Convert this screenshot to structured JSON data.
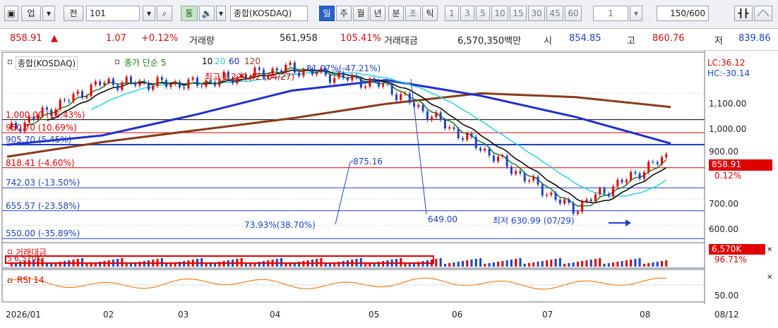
{
  "toolbar": {
    "market_label": "업",
    "period_label": "전",
    "code": "101",
    "mode_label": "통",
    "index_name": "종합(KOSDAQ)",
    "periods": [
      "일",
      "주",
      "월",
      "년",
      "분",
      "초",
      "틱"
    ],
    "active_period": "일",
    "intervals": [
      "1",
      "3",
      "5",
      "10",
      "15",
      "30",
      "45",
      "60"
    ],
    "interval_value": "1",
    "count_display": "150/600"
  },
  "quote": {
    "price": "858.91",
    "change_arrow": "▲",
    "change": "1.07",
    "change_pct": "+0.12%",
    "volume_label": "거래량",
    "volume": "561,958",
    "volume_ratio": "105.41%",
    "amount_label": "거래대금",
    "amount": "6,570,350백만",
    "open_label": "시",
    "open": "854.85",
    "high_label": "고",
    "high": "860.76",
    "low_label": "저",
    "low": "839.86"
  },
  "legend": {
    "index_label": "종합(KOSDAQ)",
    "ma_label": "종가 단순 5",
    "ma_10": "10",
    "ma_20": "20",
    "ma_60": "60",
    "ma_120": "120",
    "volume_label": "거래대금",
    "volume_ma": "5",
    "volume_ma_value": "6,570K",
    "rsi_label": "RSI 14"
  },
  "annotations": {
    "hi_label": "최고 1,229.42 (04/27)",
    "top_pct": "81.07%(-47.21%)",
    "lo_label": "최저 630.99 (07/29)",
    "mid_label": "875.16",
    "drop_label": "73.93%(38.70%)",
    "lo_point": "649.00"
  },
  "price_levels": [
    {
      "label": "1,000.00 (16.43%)",
      "value": 1000
    },
    {
      "label": "950.70 (10.69%)",
      "value": 950.7
    },
    {
      "label": "905.70 (5.45%)",
      "value": 905.7
    },
    {
      "label": "818.41 (-4.60%)",
      "value": 818.41
    },
    {
      "label": "742.03 (-13.50%)",
      "value": 742.03
    },
    {
      "label": "655.57 (-23.58%)",
      "value": 655.57
    },
    {
      "label": "550.00 (-35.89%)",
      "value": 550
    }
  ],
  "right_axis": {
    "price_ticks": [
      "1,100.00",
      "1,000.00",
      "900.00",
      "700.00",
      "600.00"
    ],
    "lc": "LC:36.12",
    "hc": "HC:-30.14",
    "current_price": "858.91",
    "current_pct": "0.12%",
    "vol_value": "6,570K",
    "vol_pct": "96.71%",
    "rsi_tick": "50.00"
  },
  "time_axis": {
    "labels": [
      "2026/01",
      "02",
      "03",
      "04",
      "05",
      "06",
      "07",
      "08"
    ],
    "end_label": "08/12"
  },
  "chart_data": {
    "type": "candlestick",
    "title": "종합(KOSDAQ)",
    "ylim": [
      540,
      1250
    ],
    "x_months": [
      "2026/01",
      "02",
      "03",
      "04",
      "05",
      "06",
      "07",
      "08"
    ],
    "highest": {
      "value": 1229.42,
      "date": "04/27"
    },
    "lowest": {
      "value": 630.99,
      "date": "07/29"
    },
    "last": {
      "value": 858.91,
      "date": "08/12"
    },
    "ma_periods": [
      5,
      10,
      20,
      60,
      120
    ],
    "ma_colors": {
      "5": "#e0a000",
      "10": "#000000",
      "20": "#2ed0e0",
      "60": "#1f2fcf",
      "120": "#8a3a1a"
    },
    "close_by_month": [
      {
        "month": "2026/01",
        "close": 955
      },
      {
        "month": "02",
        "close": 1140
      },
      {
        "month": "03",
        "close": 1135
      },
      {
        "month": "04",
        "close": 1195
      },
      {
        "month": "05",
        "close": 1130
      },
      {
        "month": "06",
        "close": 900
      },
      {
        "month": "07",
        "close": 660
      },
      {
        "month": "08",
        "close": 858.91
      }
    ],
    "ma60_by_month": [
      {
        "month": "2026/01",
        "value": 905
      },
      {
        "month": "02",
        "value": 940
      },
      {
        "month": "03",
        "value": 1020
      },
      {
        "month": "04",
        "value": 1110
      },
      {
        "month": "05",
        "value": 1150
      },
      {
        "month": "06",
        "value": 1090
      },
      {
        "month": "07",
        "value": 1010
      },
      {
        "month": "08",
        "value": 910
      }
    ],
    "ma120_by_month": [
      {
        "month": "2026/01",
        "value": 860
      },
      {
        "month": "02",
        "value": 915
      },
      {
        "month": "03",
        "value": 960
      },
      {
        "month": "04",
        "value": 1005
      },
      {
        "month": "05",
        "value": 1060
      },
      {
        "month": "06",
        "value": 1100
      },
      {
        "month": "07",
        "value": 1085
      },
      {
        "month": "08",
        "value": 1048
      }
    ],
    "rsi_tick": 50
  }
}
